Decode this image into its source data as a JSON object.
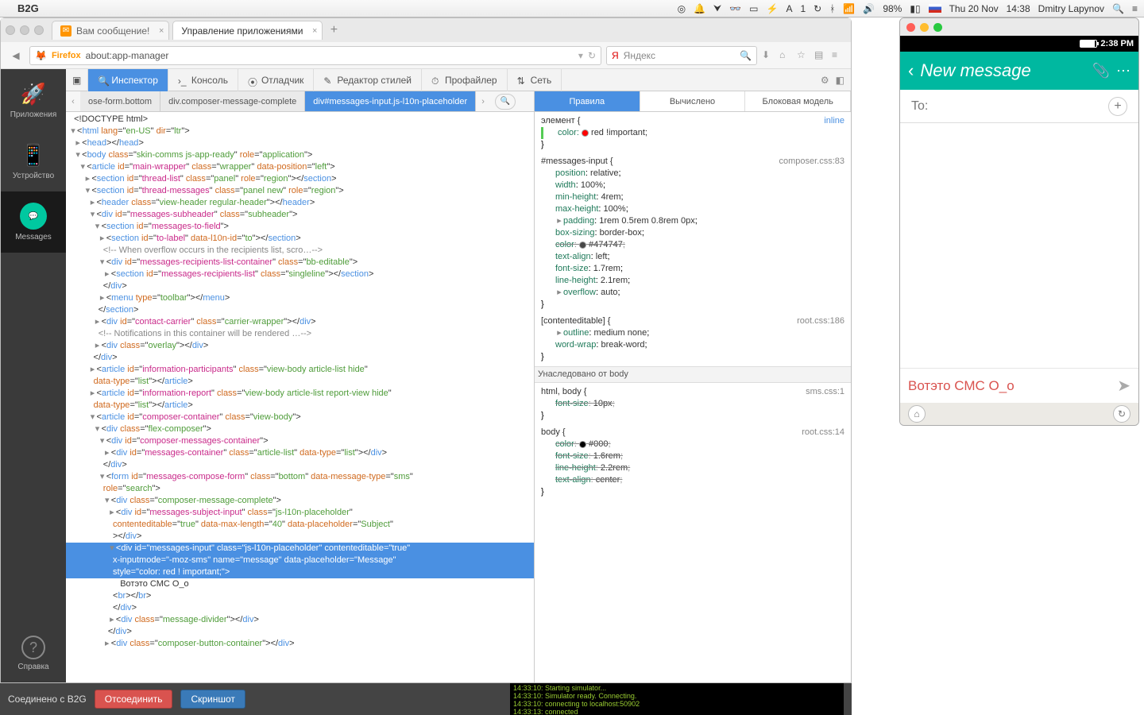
{
  "menubar": {
    "app": "B2G",
    "battery": "98%",
    "date": "Thu 20 Nov",
    "time": "14:38",
    "user": "Dmitry Lapynov"
  },
  "tabs": {
    "t1": "Вам сообщение!",
    "t2": "Управление приложениями"
  },
  "urlbar": {
    "firefox": "Firefox",
    "url": "about:app-manager",
    "search_placeholder": "Яндекс"
  },
  "rail": {
    "apps": "Приложения",
    "device": "Устройство",
    "messages": "Messages",
    "help": "Справка"
  },
  "devtools": {
    "inspector": "Инспектор",
    "console": "Консоль",
    "debugger": "Отладчик",
    "style": "Редактор стилей",
    "profiler": "Профайлер",
    "network": "Сеть"
  },
  "crumbs": {
    "c1": "ose-form.bottom",
    "c2": "div.composer-message-complete",
    "c3": "div#messages-input.js-l10n-placeholder"
  },
  "rules_tabs": {
    "rules": "Правила",
    "computed": "Вычислено",
    "box": "Блоковая модель"
  },
  "rules": {
    "elem": "элемент",
    "inline": "inline",
    "r1_prop": "color:",
    "r1_val": "red !important;",
    "sel1": "#messages-input {",
    "file1": "composer.css:83",
    "p1": "position: relative;",
    "p2": "width: 100%;",
    "p3": "min-height: 4rem;",
    "p4": "max-height: 100%;",
    "p5": "padding: 1rem 0.5rem 0.8rem 0px;",
    "p6": "box-sizing: border-box;",
    "p7": "color:   #474747;",
    "p8": "text-align: left;",
    "p9": "font-size: 1.7rem;",
    "p10": "line-height: 2.1rem;",
    "p11": "overflow: auto;",
    "sel2": "[contenteditable] {",
    "file2": "root.css:186",
    "p12": "outline: medium none;",
    "p13": "word-wrap: break-word;",
    "inherit": "Унаследовано от body",
    "sel3": "html, body {",
    "file3": "sms.css:1",
    "p14": "font-size: 10px;",
    "sel4": "body {",
    "file4": "root.css:14",
    "p15": "color:   #000;",
    "p16": "font-size: 1.6rem;",
    "p17": "line-height: 2.2rem;",
    "p18": "text-align: center;"
  },
  "status": {
    "connected": "Соединено с B2G",
    "disconnect": "Отсоединить",
    "screenshot": "Скриншот",
    "log1": "14:33:10: Starting simulator...",
    "log2": "14:33:10: Simulator ready. Connecting.",
    "log3": "14:33:10: connecting to localhost:50902",
    "log4": "14:33:13: connected"
  },
  "phone": {
    "time": "2:38 PM",
    "title": "New message",
    "to": "To:",
    "compose": "Вотэто СМС О_о"
  },
  "dom": {
    "text": "Вотэто СМС O_o"
  }
}
